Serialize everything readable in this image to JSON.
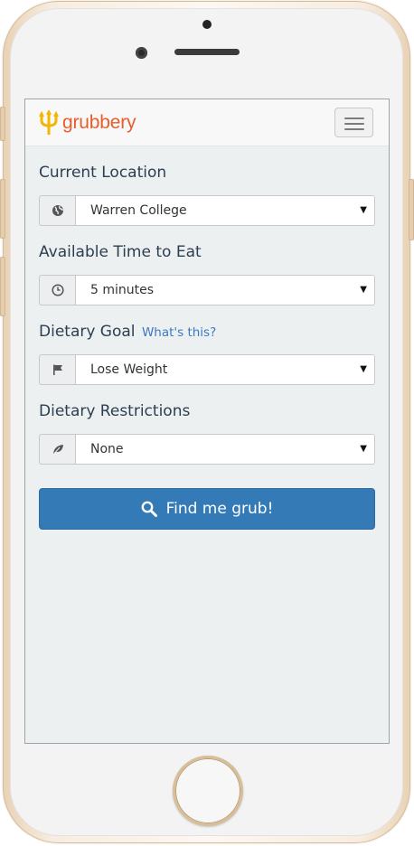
{
  "app": {
    "brand": "grubbery",
    "brand_color": "#e85d2c"
  },
  "form": {
    "location": {
      "label": "Current Location",
      "icon": "globe-icon",
      "value": "Warren College"
    },
    "time": {
      "label": "Available Time to Eat",
      "icon": "clock-icon",
      "value": "5 minutes"
    },
    "goal": {
      "label": "Dietary Goal",
      "help_link": "What's this?",
      "icon": "flag-icon",
      "value": "Lose Weight"
    },
    "restrictions": {
      "label": "Dietary Restrictions",
      "icon": "leaf-icon",
      "value": "None"
    },
    "submit": {
      "label": "Find me grub!",
      "icon": "search-icon",
      "color": "#337ab7"
    }
  }
}
